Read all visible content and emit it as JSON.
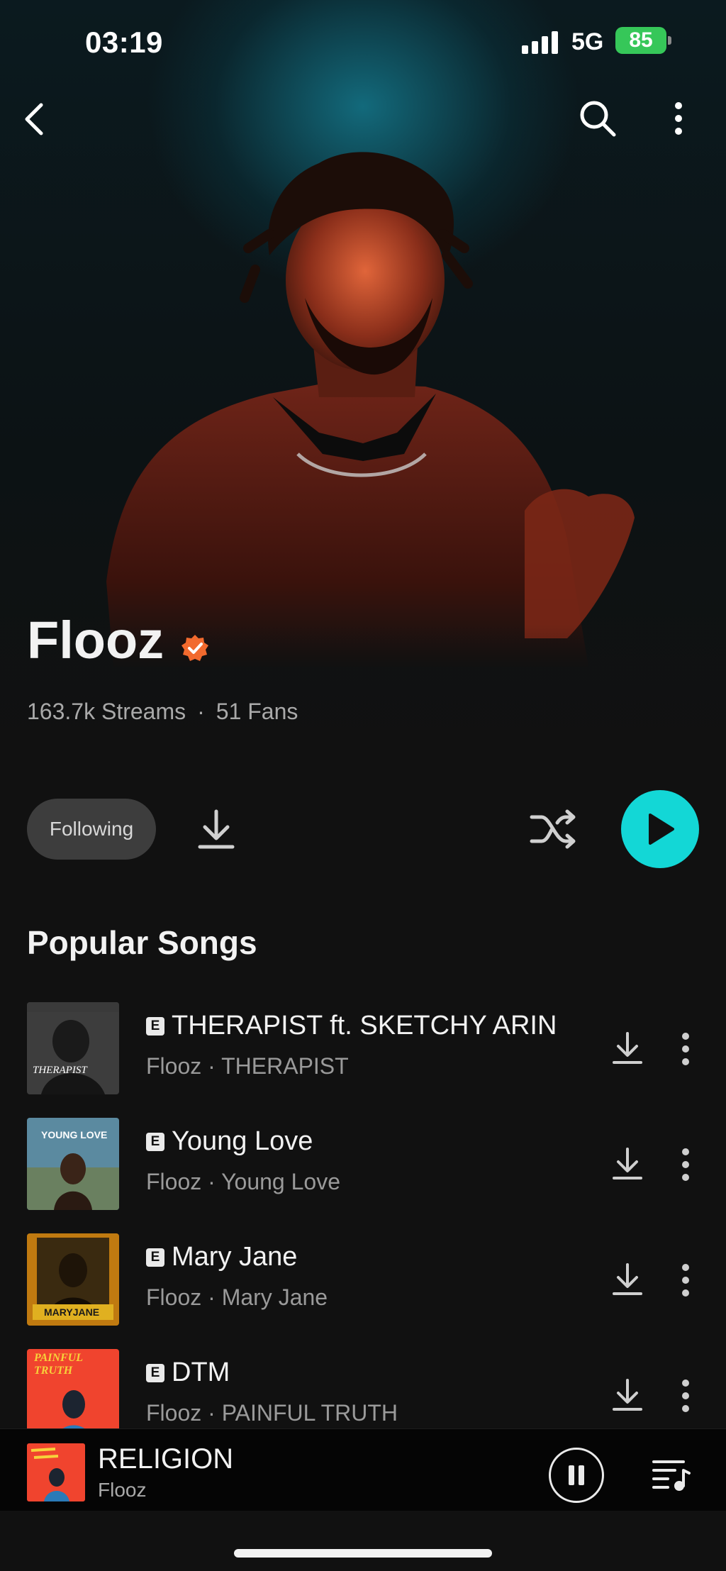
{
  "status_bar": {
    "time": "03:19",
    "network": "5G",
    "battery": "85"
  },
  "artist": {
    "name": "Flooz",
    "streams": "163.7k Streams",
    "separator": "·",
    "fans": "51 Fans"
  },
  "actions": {
    "following_label": "Following"
  },
  "section": {
    "popular_title": "Popular Songs"
  },
  "songs": [
    {
      "title": "THERAPIST ft. SKETCHY ARIN",
      "subtitle": "Flooz · THERAPIST",
      "explicit": "E",
      "cover_text": "THERAPIST"
    },
    {
      "title": "Young Love",
      "subtitle": "Flooz · Young Love",
      "explicit": "E",
      "cover_text": "YOUNG LOVE"
    },
    {
      "title": "Mary Jane",
      "subtitle": "Flooz · Mary Jane",
      "explicit": "E",
      "cover_text": "MARYJANE"
    },
    {
      "title": "DTM",
      "subtitle": "Flooz · PAINFUL TRUTH",
      "explicit": "E",
      "cover_text": "PAINFUL TRUTH"
    }
  ],
  "now_playing": {
    "title": "RELIGION",
    "artist": "Flooz"
  },
  "colors": {
    "accent": "#13d7d6",
    "verified": "#f26a2e",
    "battery": "#36c759",
    "background": "#111111"
  },
  "icons": {
    "back": "chevron-left-icon",
    "search": "search-icon",
    "more": "more-vertical-icon",
    "verified": "verified-badge-icon",
    "download": "download-icon",
    "shuffle": "shuffle-icon",
    "play": "play-icon",
    "pause": "pause-icon",
    "queue": "queue-music-icon"
  }
}
